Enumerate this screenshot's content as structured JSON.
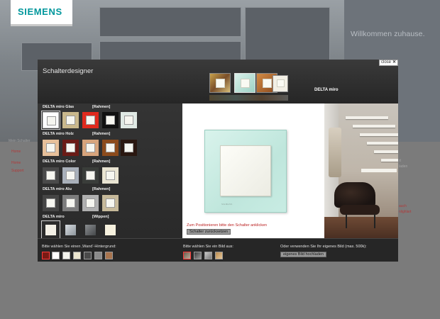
{
  "site": {
    "logo": "SIEMENS",
    "welcome": "Willkommen zuhause.",
    "nav_heading": "Mein Schalter",
    "nav_items": [
      "Home",
      "Home",
      "Support"
    ],
    "side_texts": [
      "rt",
      "laden",
      "auch",
      "nlighlart"
    ]
  },
  "modal": {
    "title": "Schalterdesigner",
    "close_label": "close",
    "close_icon": "x-icon",
    "series_label": "DELTA miro",
    "groups": [
      {
        "name": "DELTA miro Glas",
        "kind": "[Rahmen]"
      },
      {
        "name": "DELTA miro Holz",
        "kind": "[Rahmen]"
      },
      {
        "name": "DELTA miro Color",
        "kind": "[Rahmen]"
      },
      {
        "name": "DELTA miro Alu",
        "kind": "[Rahmen]"
      },
      {
        "name": "DELTA miro",
        "kind": "[Wippen]"
      }
    ],
    "swatch_colors": {
      "glas": [
        "#ffffff",
        "#c9b88c",
        "#e02a1e",
        "#111111",
        "#dfe9e4"
      ],
      "holz": [
        "#e7c09a",
        "#6a1b16",
        "#d7a47c",
        "#8c4b1c",
        "#2a1710"
      ],
      "color": [
        "#4a4a4a",
        "#a9b0ba",
        "#3a3d3a",
        "#e9e4d2"
      ],
      "alu": [
        "#454545",
        "#7c7c7c",
        "#b0b0b0",
        "#c6b99a"
      ],
      "wippen": [
        "#f3f0e6",
        "#b8bfc5",
        "#6a6d70",
        "#f6f1de"
      ]
    },
    "preview": {
      "brand_text": "SIEMENS",
      "hint": "Zum Positionieren bitte den Schalter anklicken",
      "reset_label": "Schalter zurücksetzen",
      "frame_color": "#c6ebe1"
    },
    "bottom": {
      "wall_label": "Bitte wählen Sie einen ‚Wand‘-Hintergrund:",
      "wall_colors": [
        "#7a1a14",
        "#ffffff",
        "#f4f4ee",
        "#ece6cf",
        "#4a4a4a",
        "#8a8a8a",
        "#a8744e"
      ],
      "image_label": "Bitte wählen Sie ein Bild aus:",
      "own_label": "Oder verwenden Sie Ihr eigenes Bild (max. 500k):",
      "upload_label": "eigenes Bild hochladen"
    }
  }
}
